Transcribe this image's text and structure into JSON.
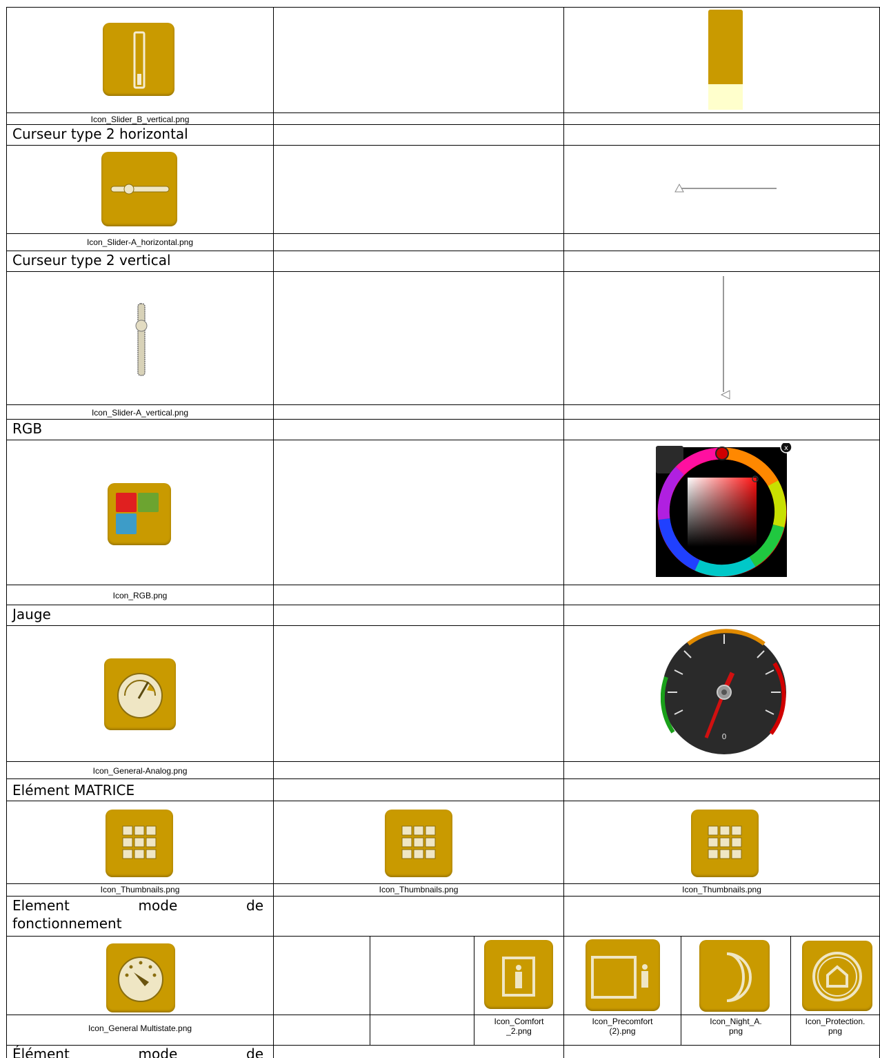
{
  "rows": {
    "slider_b_vertical": {
      "icon_file": "Icon_Slider_B_vertical.png"
    },
    "curseur_2_horizontal": {
      "title": "Curseur type 2 horizontal",
      "icon_file": "Icon_Slider-A_horizontal.png"
    },
    "curseur_2_vertical": {
      "title": "Curseur type 2 vertical",
      "icon_file": "Icon_Slider-A_vertical.png"
    },
    "rgb": {
      "title": "RGB",
      "icon_file": "Icon_RGB.png"
    },
    "jauge": {
      "title": "Jauge",
      "icon_file": "Icon_General-Analog.png",
      "gauge_label": "0"
    },
    "matrice": {
      "title": "Elément MATRICE",
      "icon_files": [
        "Icon_Thumbnails.png",
        "Icon_Thumbnails.png",
        "Icon_Thumbnails.png"
      ]
    },
    "mode_fonctionnement": {
      "title_words": [
        "Element",
        "mode",
        "de"
      ],
      "title_line2": "fonctionnement",
      "icon_file": "Icon_General Multistate.png",
      "sub_icons": [
        {
          "name": "comfort-icon",
          "file_line1": "Icon_Comfort",
          "file_line2": "_2.png"
        },
        {
          "name": "precomfort-icon",
          "file_line1": "Icon_Precomfort",
          "file_line2": "(2).png"
        },
        {
          "name": "night-icon",
          "file_line1": "Icon_Night_A.",
          "file_line2": "png"
        },
        {
          "name": "protection-icon",
          "file_line1": "Icon_Protection.",
          "file_line2": "png"
        }
      ]
    },
    "mode_2": {
      "title_words": [
        "Élément",
        "mode",
        "de"
      ]
    }
  },
  "colors": {
    "tile_gold": "#c99a00",
    "cream": "#ffffcc",
    "border": "#000000"
  }
}
